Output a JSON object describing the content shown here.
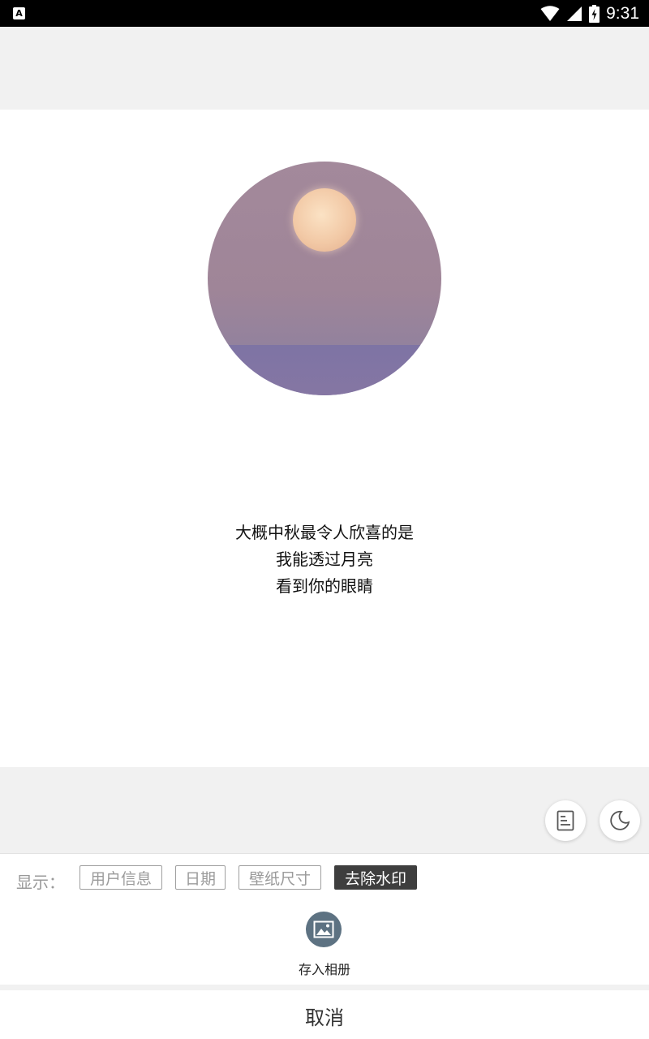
{
  "status_bar": {
    "time": "9:31",
    "app_icon_letter": "A",
    "icons": [
      "wifi-icon",
      "signal-icon",
      "battery-charging-icon"
    ]
  },
  "quote": {
    "lines": [
      "大概中秋最令人欣喜的是",
      "我能透过月亮",
      "看到你的眼睛"
    ]
  },
  "side_buttons": [
    "document-icon",
    "moon-icon"
  ],
  "display_options": {
    "label": "显示：",
    "chips": [
      {
        "label": "用户信息",
        "active": false
      },
      {
        "label": "日期",
        "active": false
      },
      {
        "label": "壁纸尺寸",
        "active": false
      },
      {
        "label": "去除水印",
        "active": true
      }
    ]
  },
  "actions": {
    "save_label": "存入相册",
    "save_icon": "image-icon"
  },
  "cancel_label": "取消",
  "colors": {
    "active_chip": "#3e3e3e",
    "save_icon_bg": "#5d7282",
    "page_bg": "#f1f1f1"
  }
}
